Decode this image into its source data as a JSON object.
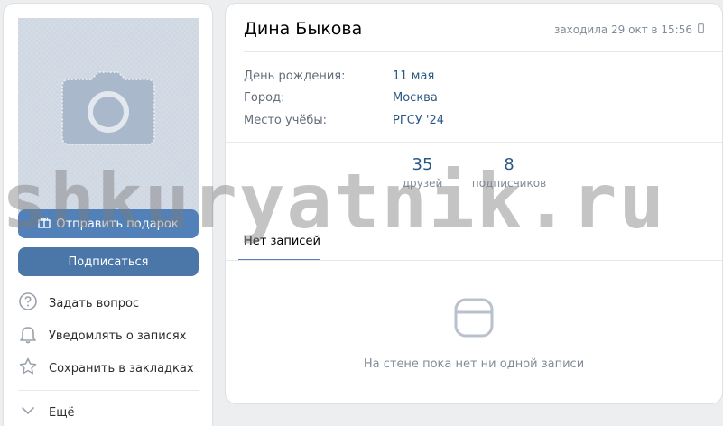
{
  "profile": {
    "name": "Дина Быкова",
    "last_seen": "заходила 29 окт в 15:56",
    "info": [
      {
        "label": "День рождения:",
        "value": "11 мая"
      },
      {
        "label": "Город:",
        "value": "Москва"
      },
      {
        "label": "Место учёбы:",
        "value": "РГСУ '24"
      }
    ],
    "counters": [
      {
        "value": "35",
        "label": "друзей"
      },
      {
        "value": "8",
        "label": "подписчиков"
      }
    ]
  },
  "actions": {
    "gift_label": "Отправить подарок",
    "subscribe_label": "Подписаться"
  },
  "menu": [
    {
      "icon": "question-icon",
      "label": "Задать вопрос"
    },
    {
      "icon": "bell-icon",
      "label": "Уведомлять о записях"
    },
    {
      "icon": "star-icon",
      "label": "Сохранить в закладках"
    },
    {
      "icon": "chevron-down-icon",
      "label": "Ещё"
    }
  ],
  "wall": {
    "tab_label": "Нет записей",
    "empty_text": "На стене пока нет ни одной записи"
  },
  "watermark": "shkuryatnik.ru",
  "colors": {
    "accent": "#5181b8",
    "link": "#2a5885",
    "background": "#edeef0"
  }
}
